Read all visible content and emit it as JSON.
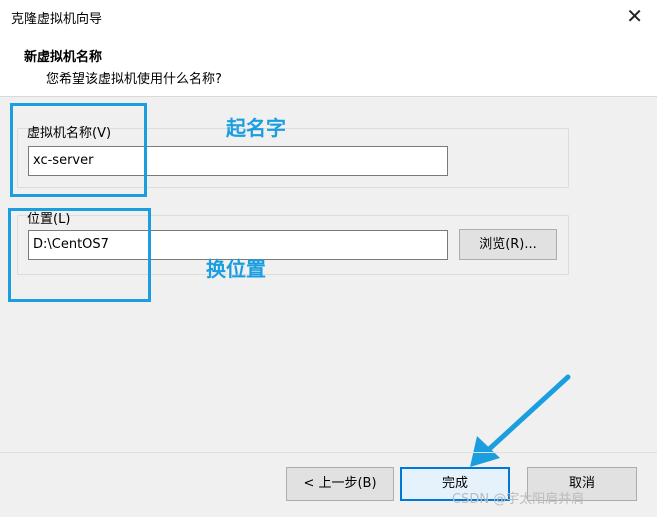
{
  "window": {
    "title": "克隆虚拟机向导",
    "close_glyph": "✕"
  },
  "header": {
    "heading": "新虚拟机名称",
    "subheading": "您希望该虚拟机使用什么名称?"
  },
  "name_group": {
    "label": "虚拟机名称(V)",
    "value": "xc-server"
  },
  "location_group": {
    "label": "位置(L)",
    "value": "D:\\CentOS7",
    "browse_label": "浏览(R)..."
  },
  "buttons": {
    "back": "< 上一步(B)",
    "finish": "完成",
    "cancel": "取消"
  },
  "annotations": {
    "name_note": "起名字",
    "location_note": "换位置"
  },
  "watermark": "CSDN @宇太阳肩并肩",
  "colors": {
    "annotation": "#1a9ee0",
    "primary_button_border": "#0078d7"
  }
}
